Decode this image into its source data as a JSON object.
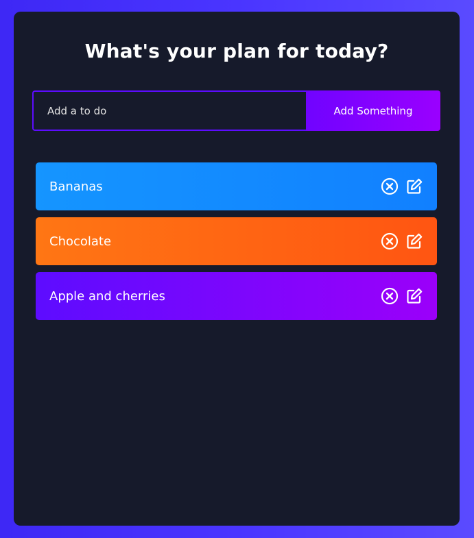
{
  "header": {
    "title": "What's your plan for today?"
  },
  "form": {
    "placeholder": "Add a to do",
    "value": "",
    "button_label": "Add Something"
  },
  "todos": [
    {
      "text": "Bananas",
      "gradient_from": "#1595ff",
      "gradient_to": "#1180ff",
      "remove_icon": "remove-circle-icon",
      "edit_icon": "edit-icon"
    },
    {
      "text": "Chocolate",
      "gradient_from": "#ff7614",
      "gradient_to": "#ff5512",
      "remove_icon": "remove-circle-icon",
      "edit_icon": "edit-icon"
    },
    {
      "text": "Apple and cherries",
      "gradient_from": "#5d0cff",
      "gradient_to": "#9b00fa",
      "remove_icon": "remove-circle-icon",
      "edit_icon": "edit-icon"
    }
  ],
  "colors": {
    "background_start": "#3e28f5",
    "background_end": "#5a4bff",
    "panel": "#161a2b",
    "input_border": "#5d0cff",
    "button_start": "#7003ff",
    "button_end": "#9a00ff",
    "text": "#ffffff"
  }
}
